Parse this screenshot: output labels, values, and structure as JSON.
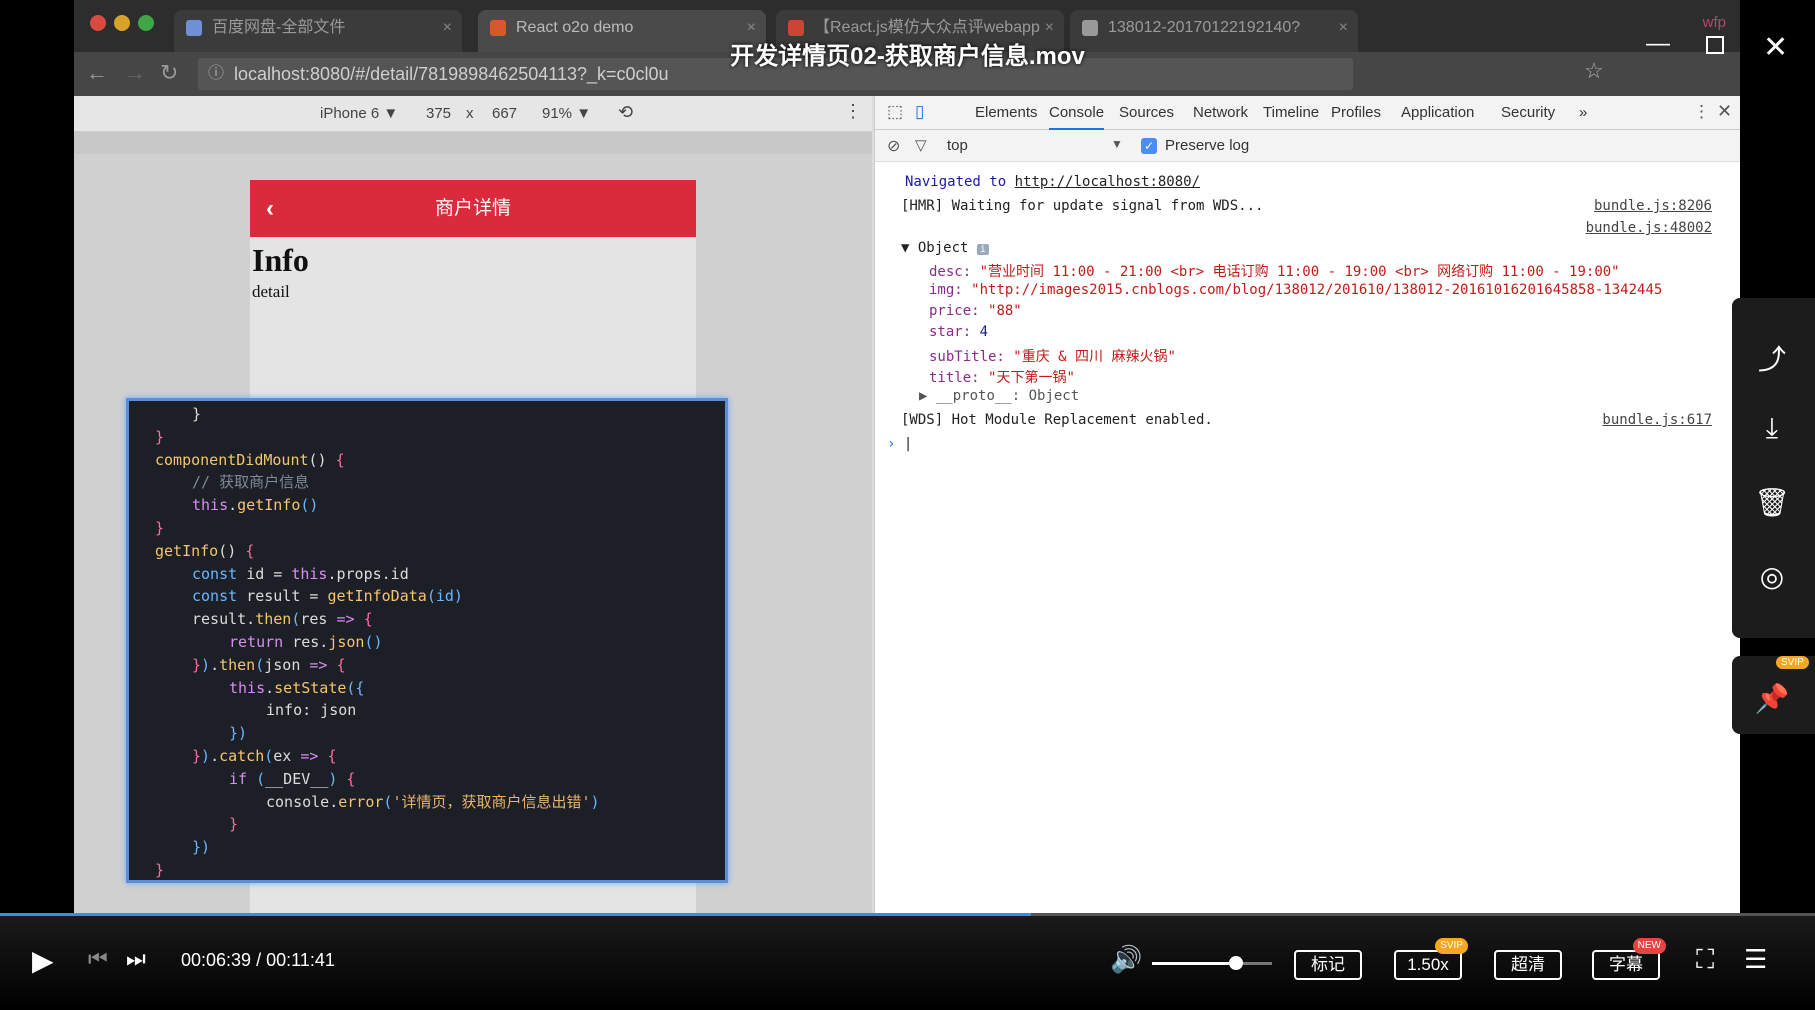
{
  "video": {
    "title": "开发详情页02-获取商户信息.mov",
    "current_time": "00:06:39",
    "duration": "00:11:41",
    "time_separator": "/",
    "progress": 0.568
  },
  "browser": {
    "tabs": [
      {
        "label": "百度网盘-全部文件",
        "color": "#6f8fd6"
      },
      {
        "label": "React o2o demo",
        "color": "#d9582b"
      },
      {
        "label": "【React.js模仿大众点评webapp",
        "color": "#c43"
      },
      {
        "label": "138012-20170122192140?",
        "color": "#999"
      }
    ],
    "profile": "wfp",
    "url": "localhost:8080/#/detail/7819898462504113?_k=c0cl0u"
  },
  "devbar": {
    "device": "iPhone 6 ▼",
    "width": "375",
    "x": "x",
    "height": "667",
    "zoom": "91% ▼"
  },
  "phone": {
    "header": "商户详情",
    "info": "Info",
    "detail": "detail"
  },
  "code_lines": [
    {
      "indent": 1,
      "parts": [
        [
          "t",
          "}"
        ]
      ]
    },
    {
      "indent": 0,
      "parts": [
        [
          "p",
          "}"
        ]
      ]
    },
    {
      "indent": 0,
      "parts": [
        [
          "f",
          "componentDidMount"
        ],
        [
          "t",
          "() "
        ],
        [
          "p",
          "{"
        ]
      ]
    },
    {
      "indent": 1,
      "parts": [
        [
          "c",
          "// 获取商户信息"
        ]
      ]
    },
    {
      "indent": 1,
      "parts": [
        [
          "k",
          "this"
        ],
        [
          "t",
          "."
        ],
        [
          "f",
          "getInfo"
        ],
        [
          "b",
          "()"
        ]
      ]
    },
    {
      "indent": 0,
      "parts": [
        [
          "p",
          "}"
        ]
      ]
    },
    {
      "indent": 0,
      "parts": [
        [
          "f",
          "getInfo"
        ],
        [
          "t",
          "() "
        ],
        [
          "p",
          "{"
        ]
      ]
    },
    {
      "indent": 1,
      "parts": [
        [
          "b",
          "const "
        ],
        [
          "t",
          "id = "
        ],
        [
          "k",
          "this"
        ],
        [
          "t",
          ".props.id"
        ]
      ]
    },
    {
      "indent": 1,
      "parts": [
        [
          "b",
          "const "
        ],
        [
          "t",
          "result = "
        ],
        [
          "f",
          "getInfoData"
        ],
        [
          "b",
          "(id)"
        ]
      ]
    },
    {
      "indent": 1,
      "parts": [
        [
          "t",
          "result."
        ],
        [
          "f",
          "then"
        ],
        [
          "b",
          "("
        ],
        [
          "t",
          "res "
        ],
        [
          "k",
          "=> "
        ],
        [
          "p",
          "{"
        ]
      ]
    },
    {
      "indent": 2,
      "parts": [
        [
          "k",
          "return "
        ],
        [
          "t",
          "res."
        ],
        [
          "f",
          "json"
        ],
        [
          "b",
          "()"
        ]
      ]
    },
    {
      "indent": 1,
      "parts": [
        [
          "p",
          "}"
        ],
        [
          "b",
          ")"
        ],
        [
          "t",
          "."
        ],
        [
          "f",
          "then"
        ],
        [
          "b",
          "("
        ],
        [
          "t",
          "json "
        ],
        [
          "k",
          "=> "
        ],
        [
          "p",
          "{"
        ]
      ]
    },
    {
      "indent": 2,
      "parts": [
        [
          "k",
          "this"
        ],
        [
          "t",
          "."
        ],
        [
          "f",
          "setState"
        ],
        [
          "b",
          "({"
        ]
      ]
    },
    {
      "indent": 3,
      "parts": [
        [
          "t",
          "info: json"
        ]
      ]
    },
    {
      "indent": 2,
      "parts": [
        [
          "b",
          "})"
        ]
      ]
    },
    {
      "indent": 1,
      "parts": [
        [
          "p",
          "}"
        ],
        [
          "b",
          ")"
        ],
        [
          "t",
          "."
        ],
        [
          "f",
          "catch"
        ],
        [
          "b",
          "("
        ],
        [
          "t",
          "ex "
        ],
        [
          "k",
          "=> "
        ],
        [
          "p",
          "{"
        ]
      ]
    },
    {
      "indent": 2,
      "parts": [
        [
          "k",
          "if "
        ],
        [
          "b",
          "("
        ],
        [
          "t",
          "__DEV__"
        ],
        [
          "b",
          ") "
        ],
        [
          "p",
          "{"
        ]
      ]
    },
    {
      "indent": 3,
      "parts": [
        [
          "t",
          "console."
        ],
        [
          "f",
          "error"
        ],
        [
          "b",
          "("
        ],
        [
          "s",
          "'详情页，获取商户信息出错'"
        ],
        [
          "b",
          ")"
        ]
      ]
    },
    {
      "indent": 2,
      "parts": [
        [
          "p",
          "}"
        ]
      ]
    },
    {
      "indent": 1,
      "parts": [
        [
          "b",
          "})"
        ]
      ]
    },
    {
      "indent": 0,
      "parts": [
        [
          "p",
          "}"
        ]
      ]
    }
  ],
  "devtools": {
    "tabs": [
      "Elements",
      "Console",
      "Sources",
      "Network",
      "Timeline",
      "Profiles",
      "Application",
      "Security",
      "»"
    ],
    "active_tab": "Console",
    "context": "top",
    "preserve_log": "Preserve log",
    "console": {
      "navigated_label": "Navigated to",
      "navigated_url": "http://localhost:8080/",
      "hmr": "[HMR] Waiting for update signal from WDS...",
      "src1": "bundle.js:8206",
      "src2": "bundle.js:48002",
      "object_label": "Object",
      "desc_key": "desc:",
      "desc_val": "\"营业时间 11:00 - 21:00 <br> 电话订购 11:00 - 19:00 <br> 网络订购 11:00 - 19:00\"",
      "img_key": "img:",
      "img_val": "\"http://images2015.cnblogs.com/blog/138012/201610/138012-20161016201645858-1342445",
      "price_key": "price:",
      "price_val": "\"88\"",
      "star_key": "star:",
      "star_val": "4",
      "subtitle_key": "subTitle:",
      "subtitle_val": "\"重庆 & 四川 麻辣火锅\"",
      "title_key": "title:",
      "title_val": "\"天下第一锅\"",
      "proto": "__proto__: Object",
      "wds": "[WDS] Hot Module Replacement enabled.",
      "src3": "bundle.js:617"
    }
  },
  "controls": {
    "mark": "标记",
    "speed": "1.50x",
    "speed_badge": "SVIP",
    "quality": "超清",
    "subtitle": "字幕",
    "subtitle_badge": "NEW",
    "volume": 0.7
  },
  "sidebar": {
    "pin_badge": "SVIP"
  }
}
